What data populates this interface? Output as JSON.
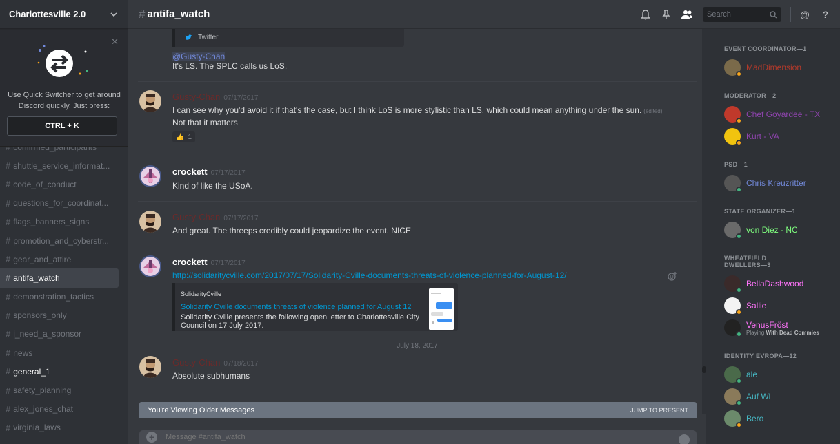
{
  "server": {
    "name": "Charlottesville 2.0"
  },
  "quick_switcher": {
    "text": "Use Quick Switcher to get around Discord quickly. Just press:",
    "shortcut": "CTRL + K"
  },
  "channels": [
    {
      "name": "confirmed_participants",
      "style": "partial"
    },
    {
      "name": "shuttle_service_informat...",
      "style": "normal"
    },
    {
      "name": "code_of_conduct",
      "style": "normal"
    },
    {
      "name": "questions_for_coordinat...",
      "style": "normal"
    },
    {
      "name": "flags_banners_signs",
      "style": "normal"
    },
    {
      "name": "promotion_and_cyberstr...",
      "style": "normal"
    },
    {
      "name": "gear_and_attire",
      "style": "normal"
    },
    {
      "name": "antifa_watch",
      "style": "active"
    },
    {
      "name": "demonstration_tactics",
      "style": "normal"
    },
    {
      "name": "sponsors_only",
      "style": "normal"
    },
    {
      "name": "i_need_a_sponsor",
      "style": "normal"
    },
    {
      "name": "news",
      "style": "normal"
    },
    {
      "name": "general_1",
      "style": "bold"
    },
    {
      "name": "safety_planning",
      "style": "normal"
    },
    {
      "name": "alex_jones_chat",
      "style": "normal"
    },
    {
      "name": "virginia_laws",
      "style": "normal"
    }
  ],
  "header": {
    "channel": "antifa_watch",
    "search_placeholder": "Search"
  },
  "chat": {
    "twitter_label": "Twitter",
    "top_mention": "@Gusty-Chan",
    "top_line": "It's LS. The SPLC calls us LoS.",
    "messages": [
      {
        "author": "Gusty-Chan",
        "timestamp": "07/17/2017",
        "line1": "I can see why you'd avoid it if that's the case, but I think LoS is more stylistic than LS, which could mean anything under the sun.",
        "edited": "(edited)",
        "line2": "Not that it matters",
        "reaction_count": "1"
      },
      {
        "author": "crockett",
        "timestamp": "07/17/2017",
        "line1": "Kind of like the USoA."
      },
      {
        "author": "Gusty-Chan",
        "timestamp": "07/17/2017",
        "line1": "And great. The threeps credibly could jeopardize the event. NICE"
      },
      {
        "author": "crockett",
        "timestamp": "07/17/2017",
        "link": "http://solidaritycville.com/2017/07/17/Solidarity-Cville-documents-threats-of-violence-planned-for-August-12/",
        "embed": {
          "provider": "SolidarityCville",
          "title": "Solidarity Cville documents threats of violence planned for August 12",
          "description": "Solidarity Cville presents the following open letter to Charlottesville City Council on 17 July 2017."
        }
      },
      {
        "author": "Gusty-Chan",
        "timestamp": "07/18/2017",
        "line1": "Absolute subhumans"
      }
    ],
    "date_separator": "July 18, 2017",
    "older_notice": "You're Viewing Older Messages",
    "jump_label": "JUMP TO PRESENT",
    "compose_placeholder": "Message #antifa_watch"
  },
  "members": {
    "groups": [
      {
        "role": "EVENT COORDINATOR—1",
        "members": [
          {
            "name": "MadDimension",
            "color": "#b33a2b",
            "status": "#faa61a"
          }
        ]
      },
      {
        "role": "MODERATOR—2",
        "members": [
          {
            "name": "Chef Goyardee - TX",
            "color": "#8e44ad",
            "status": "#faa61a"
          },
          {
            "name": "Kurt - VA",
            "color": "#8e44ad",
            "status": "#faa61a"
          }
        ]
      },
      {
        "role": "PSD—1",
        "members": [
          {
            "name": "Chris Kreuzritter",
            "color": "#7289da",
            "status": "#43b581"
          }
        ]
      },
      {
        "role": "STATE ORGANIZER—1",
        "members": [
          {
            "name": "von Diez - NC",
            "color": "#7fff7f",
            "status": "#43b581"
          }
        ]
      },
      {
        "role": "WHEATFIELD DWELLERS—3",
        "members": [
          {
            "name": "BellaDashwood",
            "color": "#ff73fa",
            "status": "#43b581"
          },
          {
            "name": "Sallie",
            "color": "#ff73fa",
            "status": "#faa61a"
          },
          {
            "name": "VenusFröst",
            "color": "#ff73fa",
            "status": "#43b581",
            "playing_prefix": "Playing",
            "playing_game": "With Dead Commies"
          }
        ]
      },
      {
        "role": "IDENTITY EVROPA—12",
        "members": [
          {
            "name": "ale",
            "color": "#46b7c3",
            "status": "#43b581"
          },
          {
            "name": "Auf Wl",
            "color": "#46b7c3",
            "status": "#43b581"
          },
          {
            "name": "Bero",
            "color": "#46b7c3",
            "status": "#faa61a"
          }
        ]
      }
    ]
  },
  "colors": {
    "accent": "#7289da",
    "link": "#0096cf",
    "gusty_name": "#6b2a2a",
    "bg_main": "#36393e",
    "bg_sidebar": "#2e3136"
  }
}
